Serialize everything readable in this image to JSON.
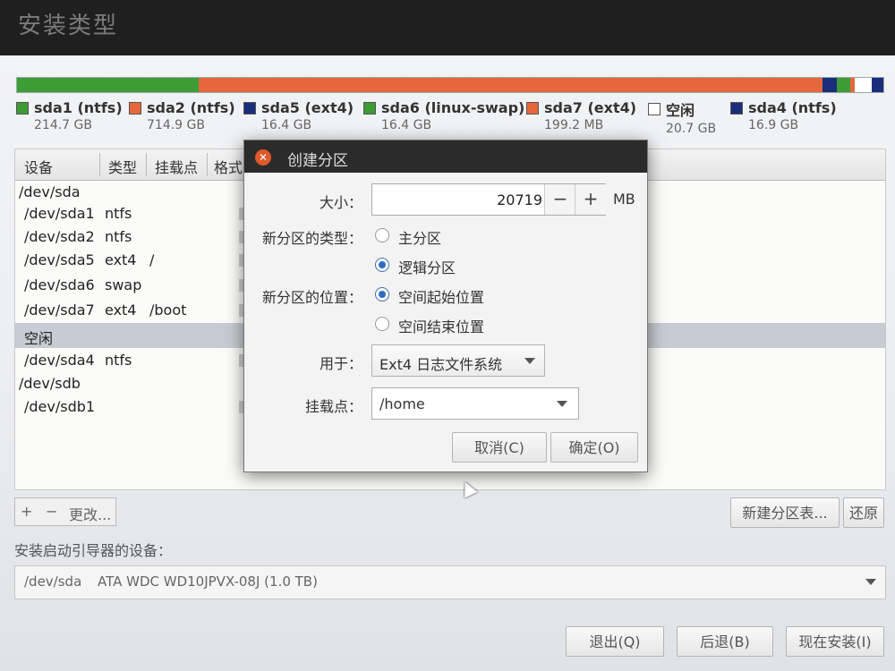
{
  "window_title": "安装类型",
  "partition_bar": [
    {
      "color": "#3d9c35",
      "fraction": 0.21
    },
    {
      "color": "#e4683b",
      "fraction": 0.72
    },
    {
      "color": "#1a2d7a",
      "fraction": 0.016
    },
    {
      "color": "#3d9c35",
      "fraction": 0.016
    },
    {
      "color": "#e4683b",
      "fraction": 0.005
    },
    {
      "color": "#ffffff",
      "fraction": 0.02
    },
    {
      "color": "#1a2d7a",
      "fraction": 0.013
    }
  ],
  "legend": [
    {
      "name": "sda1 (ntfs)",
      "size": "214.7 GB",
      "color": "#3d9c35"
    },
    {
      "name": "sda2 (ntfs)",
      "size": "714.9 GB",
      "color": "#e4683b"
    },
    {
      "name": "sda5 (ext4)",
      "size": "16.4 GB",
      "color": "#1a2d7a"
    },
    {
      "name": "sda6 (linux-swap)",
      "size": "16.4 GB",
      "color": "#3d9c35"
    },
    {
      "name": "sda7 (ext4)",
      "size": "199.2 MB",
      "color": "#e4683b"
    },
    {
      "name": "空闲",
      "size": "20.7 GB",
      "color": "#ffffff"
    },
    {
      "name": "sda4 (ntfs)",
      "size": "16.9 GB",
      "color": "#1a2d7a"
    }
  ],
  "table": {
    "headers": [
      "设备",
      "类型",
      "挂载点",
      "格式"
    ],
    "rows": [
      {
        "device": "/dev/sda",
        "type": "",
        "mount": ""
      },
      {
        "device": "/dev/sda1",
        "type": "ntfs",
        "mount": ""
      },
      {
        "device": "/dev/sda2",
        "type": "ntfs",
        "mount": ""
      },
      {
        "device": "/dev/sda5",
        "type": "ext4",
        "mount": "/"
      },
      {
        "device": "/dev/sda6",
        "type": "swap",
        "mount": ""
      },
      {
        "device": "/dev/sda7",
        "type": "ext4",
        "mount": "/boot"
      },
      {
        "device": "空闲",
        "type": "",
        "mount": ""
      },
      {
        "device": "/dev/sda4",
        "type": "ntfs",
        "mount": ""
      },
      {
        "device": "/dev/sdb",
        "type": "",
        "mount": ""
      },
      {
        "device": "/dev/sdb1",
        "type": "",
        "mount": ""
      }
    ]
  },
  "toolbar": {
    "add": "+",
    "remove": "−",
    "change": "更改..."
  },
  "new_table_button": "新建分区表...",
  "revert_button": "还原",
  "boot_label": "安装启动引导器的设备：",
  "boot_device": "/dev/sda",
  "boot_desc": "ATA WDC WD10JPVX-08J (1.0 TB)",
  "bottom_buttons": {
    "quit": "退出(Q)",
    "back": "后退(B)",
    "install": "现在安装(I)"
  },
  "dialog": {
    "title": "创建分区",
    "size_label": "大小：",
    "size_value": "20719",
    "minus": "−",
    "plus": "+",
    "unit": "MB",
    "type_label": "新分区的类型：",
    "type_options": [
      "主分区",
      "逻辑分区"
    ],
    "type_selected": 1,
    "location_label": "新分区的位置：",
    "location_options": [
      "空间起始位置",
      "空间结束位置"
    ],
    "location_selected": 0,
    "use_label": "用于：",
    "use_value": "Ext4 日志文件系统",
    "mount_label": "挂载点：",
    "mount_value": "/home",
    "cancel": "取消(C)",
    "ok": "确定(O)"
  }
}
